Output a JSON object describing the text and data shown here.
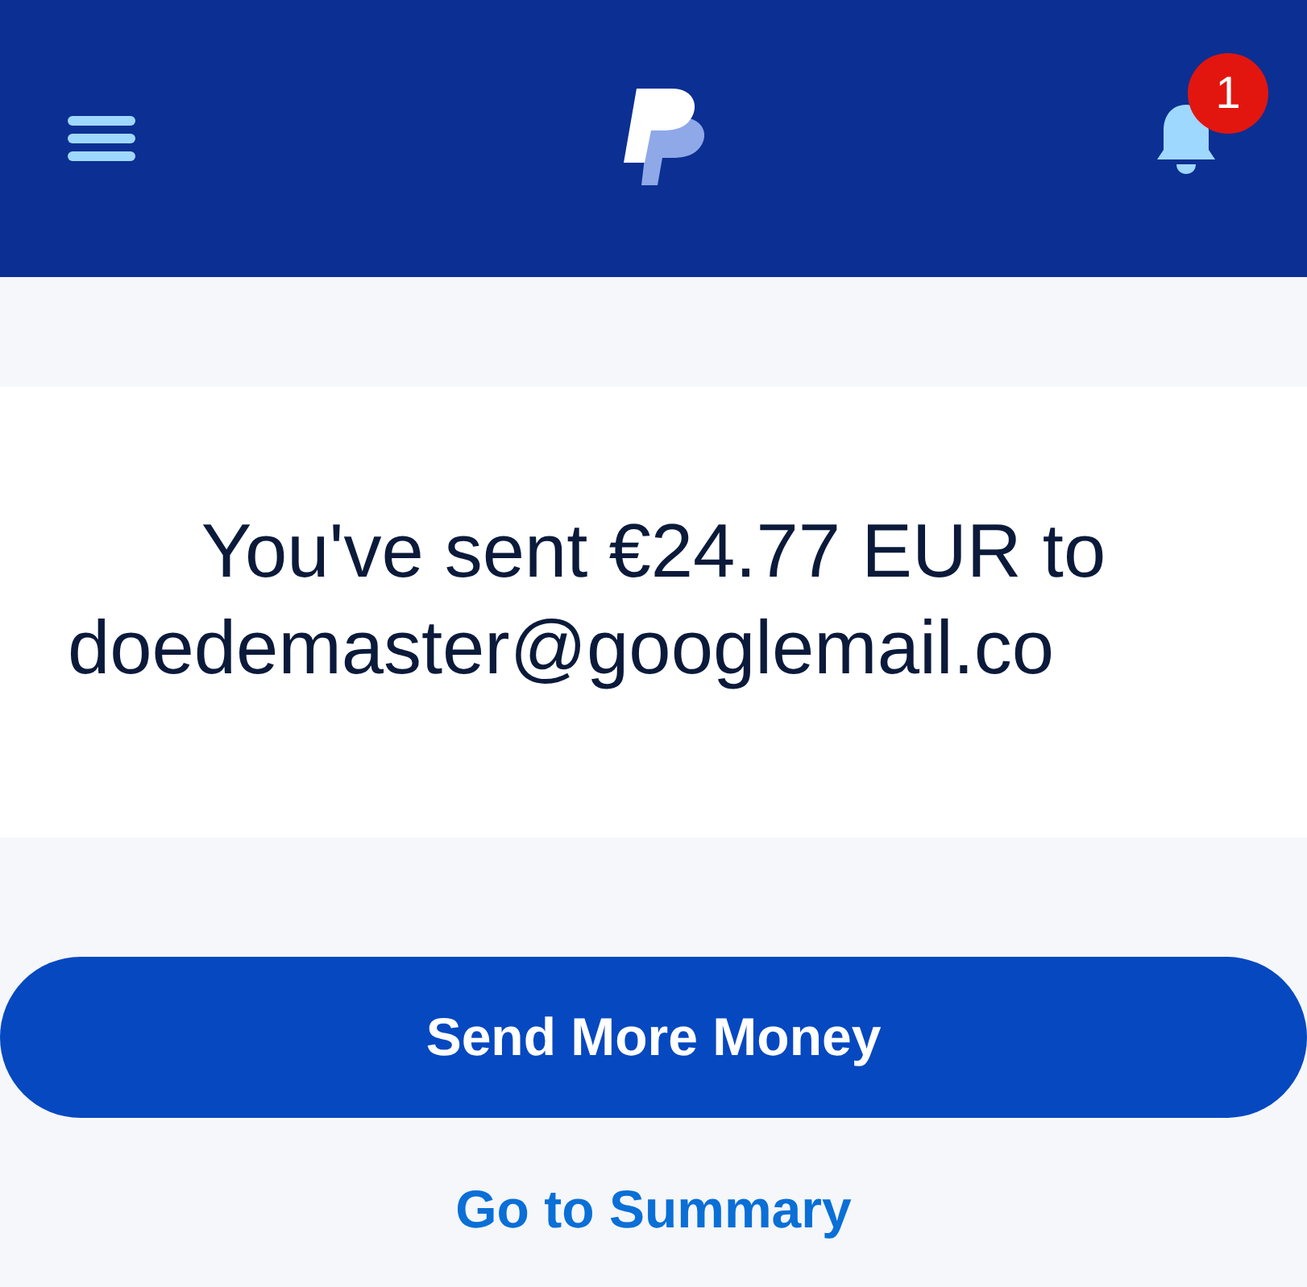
{
  "header": {
    "notification_count": "1"
  },
  "message": {
    "line_1": "You've sent €24.77 EUR to",
    "line_2": "doedemaster@googlemail.co"
  },
  "primary_button": "Send More Money",
  "link": "Go to Summary"
}
